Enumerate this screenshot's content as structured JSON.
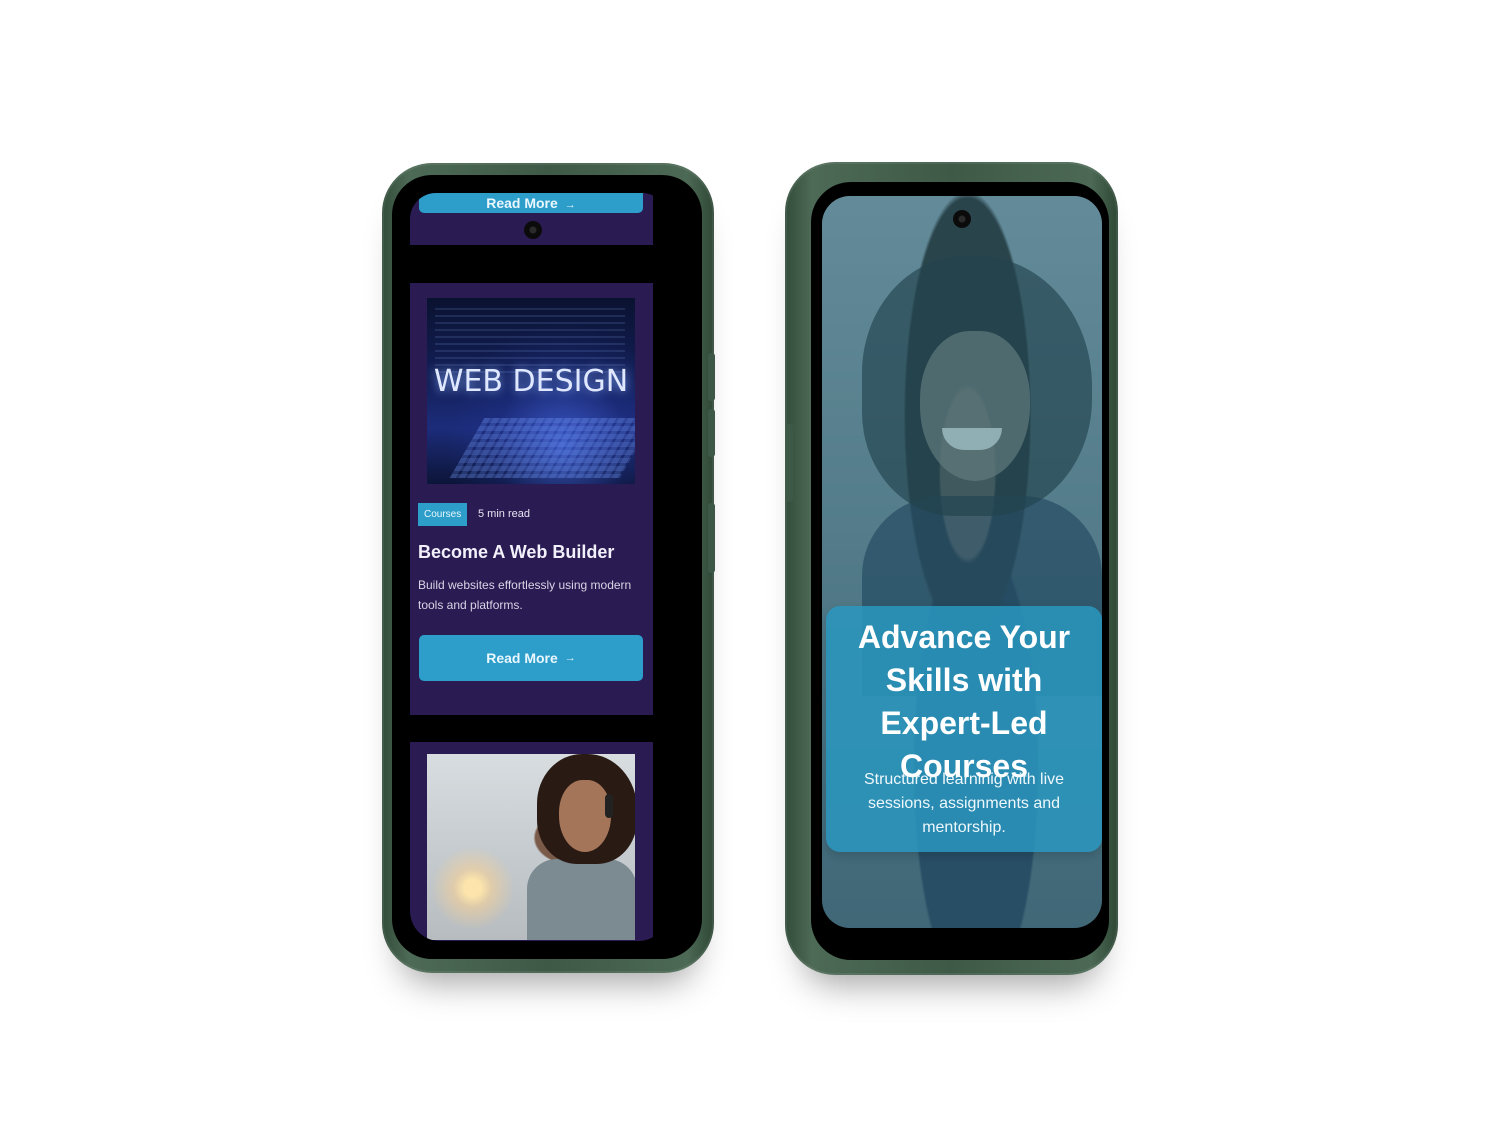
{
  "left_phone": {
    "top_card": {
      "button_label": "Read More"
    },
    "featured_card": {
      "image_text": "WEB DESIGN",
      "tag": "Courses",
      "read_time": "5 min read",
      "title": "Become A Web Builder",
      "description": "Build websites effortlessly using modern tools and platforms.",
      "button_label": "Read More",
      "button_icon": "arrow-right-icon"
    }
  },
  "right_phone": {
    "hero": {
      "title": "Advance Your Skills with Expert-Led Courses",
      "subtitle": "Structured learninig with live sessions, assignments and mentorship."
    }
  },
  "colors": {
    "card_bg": "#2a1b52",
    "accent": "#2d9dca",
    "phone_shell": "#3e5a47"
  }
}
